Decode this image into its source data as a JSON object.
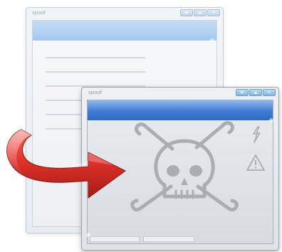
{
  "back_window": {
    "title": "spoof",
    "controls": [
      "minimize",
      "maximize",
      "close"
    ]
  },
  "front_window": {
    "title": "spoof",
    "controls": [
      "minimize",
      "maximize",
      "close"
    ],
    "icons": [
      "skull-crossbones-icon",
      "lightning-icon",
      "warning-triangle-icon"
    ]
  },
  "arrow": {
    "icon": "curved-arrow-icon",
    "color": "#e0332a"
  },
  "colors": {
    "title_bar_blue": "#3f7bd3",
    "symbol_gray": "#a9aeb3"
  }
}
